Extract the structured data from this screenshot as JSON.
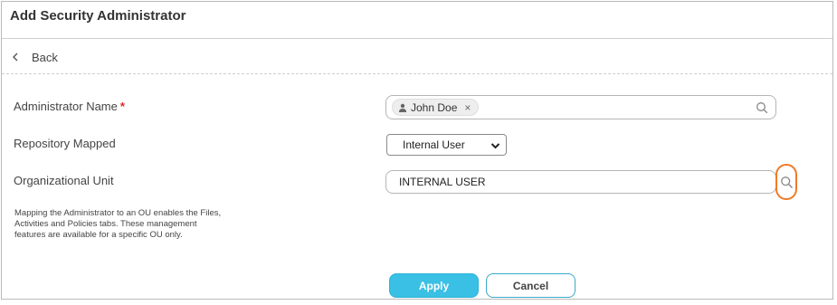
{
  "header": {
    "title": "Add Security Administrator"
  },
  "nav": {
    "back_label": "Back"
  },
  "form": {
    "admin_name": {
      "label": "Administrator Name",
      "required_mark": "*",
      "chip_label": "John Doe",
      "chip_remove": "×"
    },
    "repository": {
      "label": "Repository Mapped",
      "selected": "Internal User"
    },
    "org_unit": {
      "label": "Organizational Unit",
      "value": "INTERNAL USER"
    },
    "help_text": "Mapping the Administrator to an OU enables the Files, Activities and Policies tabs. These management features are available for a specific OU only."
  },
  "actions": {
    "apply_label": "Apply",
    "cancel_label": "Cancel"
  },
  "colors": {
    "accent": "#39c0e4",
    "highlight": "#f07a26",
    "required": "#e0262e"
  }
}
